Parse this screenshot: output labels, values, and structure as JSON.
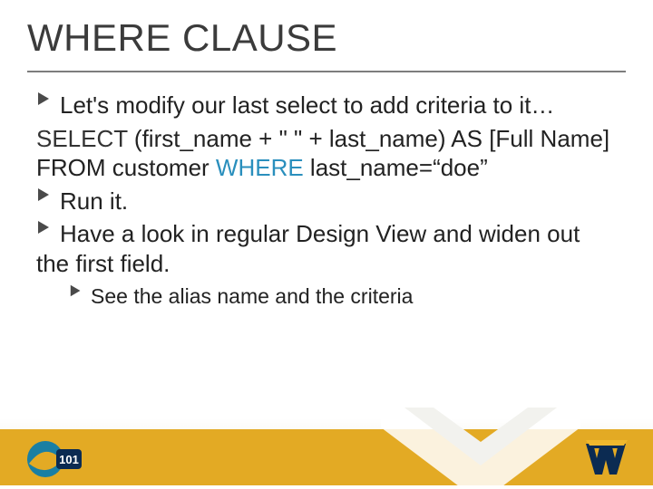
{
  "title": "WHERE CLAUSE",
  "bullets": {
    "b1": "Let's modify our last select to add criteria to it…",
    "code_select": "SELECT",
    "code_mid": " (first_name + \" \" +  last_name) AS [Full Name] FROM customer ",
    "code_where": "WHERE",
    "code_tail": " last_name=“doe”",
    "b3": "Run it.",
    "b4": "Have a look in regular Design View and widen out the first field.",
    "sub1": "See the alias name and the criteria"
  },
  "colors": {
    "accent_gold": "#e3aa24",
    "accent_blue": "#2a8fbd",
    "wv_navy": "#0b2b52",
    "wv_gold": "#f0b82d"
  },
  "icons": {
    "bullet_arrow": "chevron-right",
    "logo_left": "cs101-badge",
    "logo_right": "wv-flying-logo"
  }
}
